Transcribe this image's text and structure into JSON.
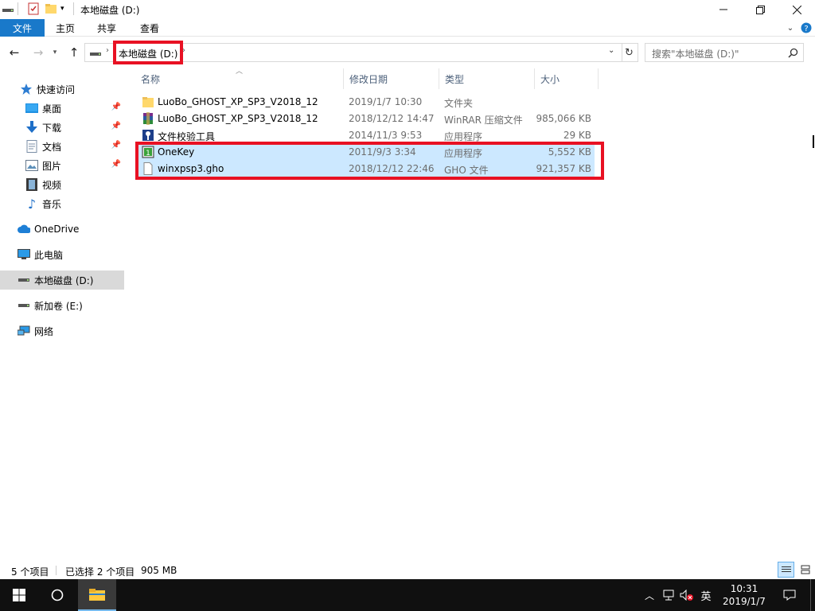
{
  "window": {
    "title": "本地磁盘 (D:)"
  },
  "ribbon": {
    "tabs": [
      "文件",
      "主页",
      "共享",
      "查看"
    ]
  },
  "address": {
    "crumb": "本地磁盘 (D:)",
    "search_placeholder": "搜索\"本地磁盘 (D:)\""
  },
  "nav": {
    "quick_access": "快速访问",
    "quick_items": [
      "桌面",
      "下载",
      "文档",
      "图片",
      "视频",
      "音乐"
    ],
    "onedrive": "OneDrive",
    "this_pc": "此电脑",
    "drive_d": "本地磁盘 (D:)",
    "drive_e": "新加卷 (E:)",
    "network": "网络"
  },
  "columns": {
    "name": "名称",
    "modified": "修改日期",
    "type": "类型",
    "size": "大小"
  },
  "files": [
    {
      "name": "LuoBo_GHOST_XP_SP3_V2018_12",
      "modified": "2019/1/7 10:30",
      "type": "文件夹",
      "size": "",
      "icon": "folder-icon",
      "selected": false
    },
    {
      "name": "LuoBo_GHOST_XP_SP3_V2018_12",
      "modified": "2018/12/12 14:47",
      "type": "WinRAR 压缩文件",
      "size": "985,066 KB",
      "icon": "winrar-archive-icon",
      "selected": false
    },
    {
      "name": "文件校验工具",
      "modified": "2014/11/3 9:53",
      "type": "应用程序",
      "size": "29 KB",
      "icon": "checksum-tool-icon",
      "selected": false
    },
    {
      "name": "OneKey",
      "modified": "2011/9/3 3:34",
      "type": "应用程序",
      "size": "5,552 KB",
      "icon": "onekey-app-icon",
      "selected": true
    },
    {
      "name": "winxpsp3.gho",
      "modified": "2018/12/12 22:46",
      "type": "GHO 文件",
      "size": "921,357 KB",
      "icon": "file-icon",
      "selected": true
    }
  ],
  "status": {
    "item_count": "5 个项目",
    "selection": "已选择 2 个项目",
    "selection_size": "905 MB"
  },
  "taskbar": {
    "ime": "英",
    "time": "10:31",
    "date": "2019/1/7"
  },
  "colors": {
    "accent": "#1979ca",
    "selection": "#cce8ff",
    "highlight_red": "#e81123",
    "taskbar": "#101010"
  }
}
